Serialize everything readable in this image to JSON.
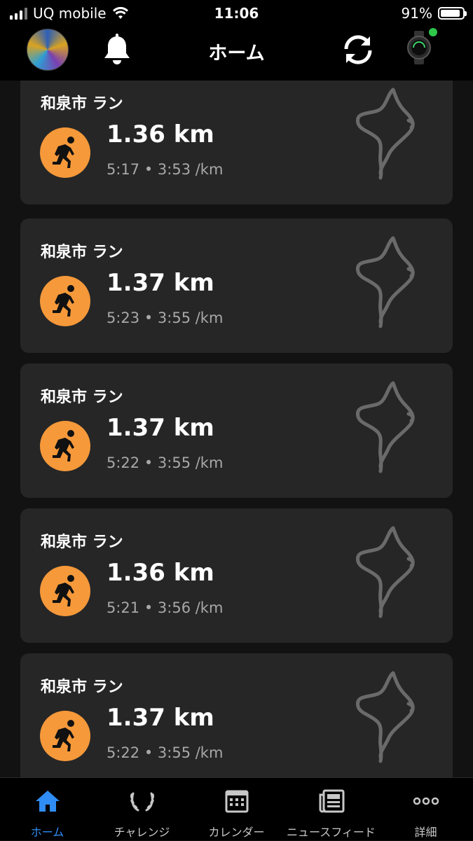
{
  "status_bar": {
    "carrier": "UQ mobile",
    "time": "11:06",
    "battery": "91%",
    "battery_level": 0.91
  },
  "header": {
    "title": "ホーム"
  },
  "activities": [
    {
      "name": "和泉市 ラン",
      "distance": "1.36 km",
      "details": "5:17 • 3:53 /km"
    },
    {
      "name": "和泉市 ラン",
      "distance": "1.37 km",
      "details": "5:23 • 3:55 /km"
    },
    {
      "name": "和泉市 ラン",
      "distance": "1.37 km",
      "details": "5:22 • 3:55 /km"
    },
    {
      "name": "和泉市 ラン",
      "distance": "1.36 km",
      "details": "5:21 • 3:56 /km"
    },
    {
      "name": "和泉市 ラン",
      "distance": "1.37 km",
      "details": "5:22 • 3:55 /km"
    }
  ],
  "tabs": [
    {
      "label": "ホーム",
      "icon": "home-icon",
      "active": true
    },
    {
      "label": "チャレンジ",
      "icon": "laurel-icon",
      "active": false
    },
    {
      "label": "カレンダー",
      "icon": "calendar-icon",
      "active": false
    },
    {
      "label": "ニュースフィード",
      "icon": "newsfeed-icon",
      "active": false
    },
    {
      "label": "詳細",
      "icon": "more-icon",
      "active": false
    }
  ],
  "colors": {
    "accent_orange": "#f6993a",
    "active_tab": "#2f8df5",
    "card_bg": "#262626",
    "connected_dot": "#2ec84a"
  }
}
